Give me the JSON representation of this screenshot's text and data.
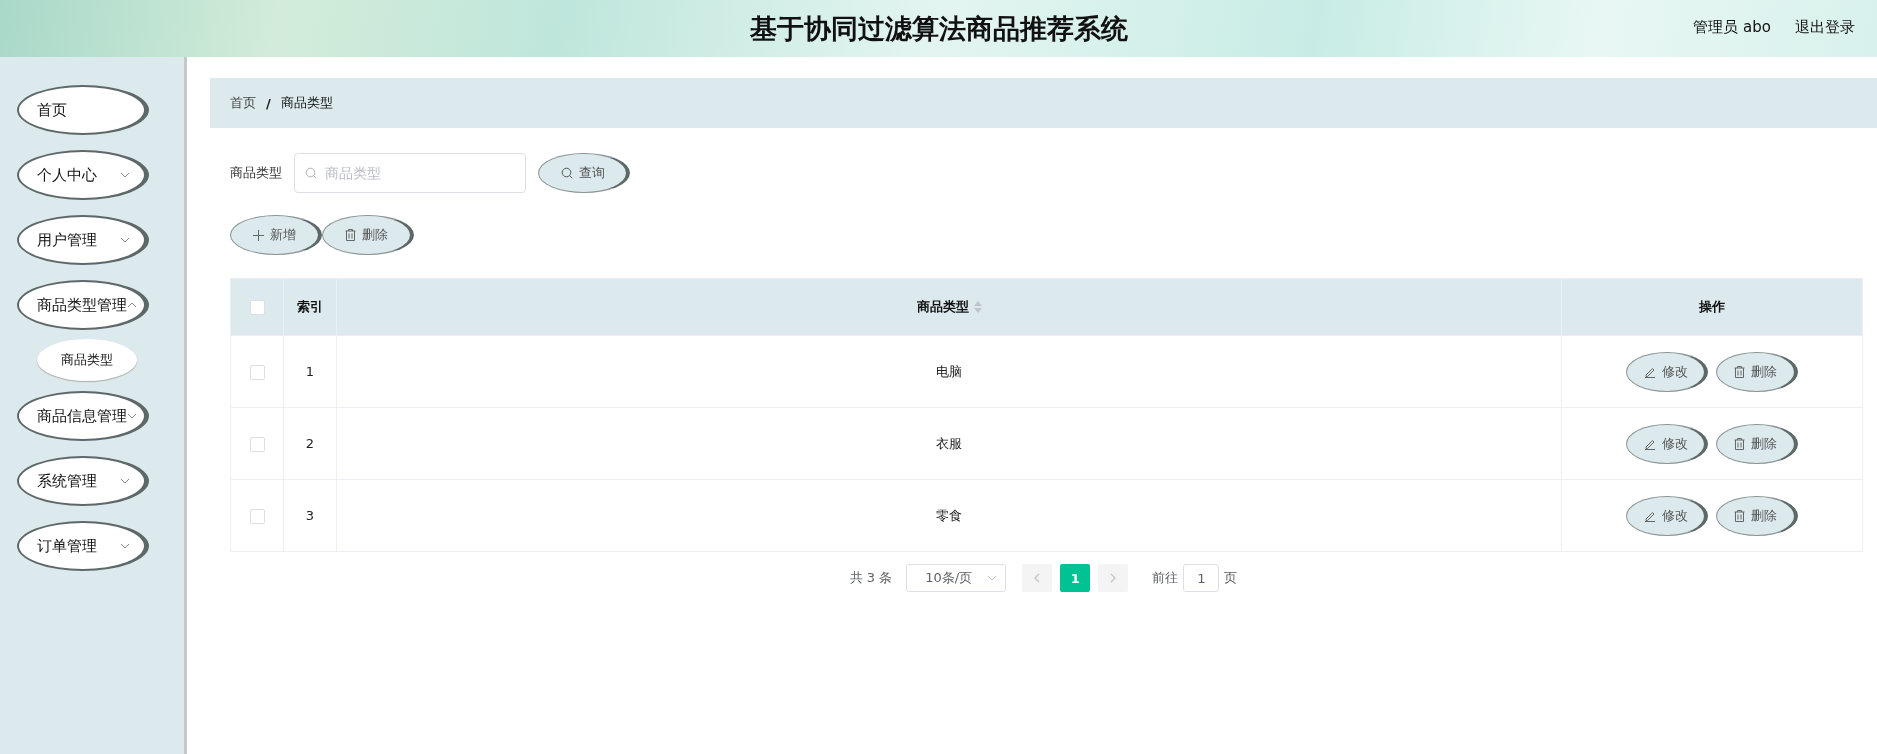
{
  "header": {
    "title": "基于协同过滤算法商品推荐系统",
    "user": "管理员 abo",
    "logout": "退出登录"
  },
  "sidebar": {
    "items": [
      {
        "label": "首页",
        "kind": "link"
      },
      {
        "label": "个人中心",
        "kind": "submenu",
        "expanded": false
      },
      {
        "label": "用户管理",
        "kind": "submenu",
        "expanded": false
      },
      {
        "label": "商品类型管理",
        "kind": "submenu",
        "expanded": true,
        "children": [
          {
            "label": "商品类型"
          }
        ]
      },
      {
        "label": "商品信息管理",
        "kind": "submenu",
        "expanded": false
      },
      {
        "label": "系统管理",
        "kind": "submenu",
        "expanded": false
      },
      {
        "label": "订单管理",
        "kind": "submenu",
        "expanded": false
      }
    ]
  },
  "breadcrumb": {
    "items": [
      "首页",
      "商品类型"
    ],
    "separator": "/"
  },
  "search": {
    "label": "商品类型",
    "placeholder": "商品类型",
    "button": "查询"
  },
  "actions": [
    {
      "label": "新增",
      "kind": "add"
    },
    {
      "label": "删除",
      "kind": "delete"
    }
  ],
  "table": {
    "select_all": {
      "checked": false
    },
    "columns": [
      "索引",
      "商品类型",
      "操作"
    ],
    "rows": [
      {
        "checked": false,
        "index": "1",
        "type": "电脑",
        "actions": [
          "修改",
          "删除"
        ]
      },
      {
        "checked": false,
        "index": "2",
        "type": "衣服",
        "actions": [
          "修改",
          "删除"
        ]
      },
      {
        "checked": false,
        "index": "3",
        "type": "零食",
        "actions": [
          "修改",
          "删除"
        ]
      }
    ]
  },
  "pagination": {
    "total": "共 3 条",
    "page_size": "10条/页",
    "pages": [
      {
        "label": "1",
        "selected": true
      }
    ],
    "goto_label": "前往",
    "goto_value": "1",
    "goto_suffix": "页"
  }
}
